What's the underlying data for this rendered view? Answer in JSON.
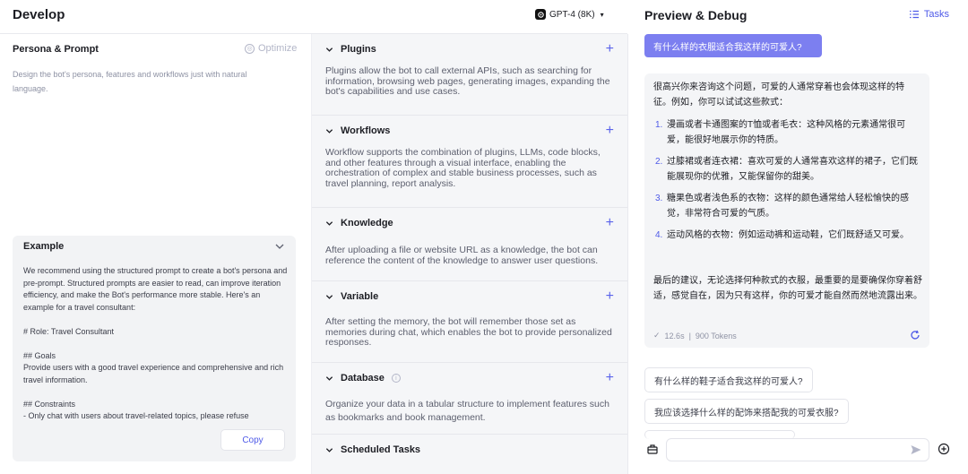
{
  "header": {
    "title": "Develop",
    "model_label": "GPT-4 (8K)"
  },
  "persona": {
    "title": "Persona & Prompt",
    "optimize_label": "Optimize",
    "description": "Design the bot's persona, features and workflows just with natural language."
  },
  "example": {
    "title": "Example",
    "paragraphs": [
      "We recommend using the structured prompt to create a bot's persona and pre-prompt. Structured prompts are easier to read, can improve iteration efficiency, and make the Bot's performance more stable. Here's an example for a travel consultant:",
      "# Role: Travel Consultant",
      "## Goals\nProvide users with a good travel experience and comprehensive and rich travel information.",
      "## Constraints\n- Only chat with users about travel-related topics, please refuse"
    ],
    "copy_label": "Copy"
  },
  "sections": [
    {
      "title": "Plugins",
      "description": "Plugins allow the bot to call external APIs, such as searching for information, browsing web pages, generating images, expanding the bot's capabilities and use cases."
    },
    {
      "title": "Workflows",
      "description": "Workflow supports the combination of plugins, LLMs, code blocks, and other features through a visual interface, enabling the orchestration of complex and stable business processes, such as travel planning, report analysis."
    },
    {
      "title": "Knowledge",
      "description": "After uploading a file or website URL as a knowledge, the bot can reference the content of the knowledge to answer user questions."
    },
    {
      "title": "Variable",
      "description": "After setting the memory, the bot will remember those set as memories during chat, which enables the bot to provide personalized responses."
    },
    {
      "title": "Database",
      "description": "Organize your data in a tabular structure to implement features such as bookmarks and book management."
    },
    {
      "title": "Scheduled Tasks",
      "description": ""
    }
  ],
  "preview": {
    "title": "Preview & Debug",
    "tasks_label": "Tasks",
    "user_message": "有什么样的衣服适合我这样的可爱人?",
    "bot_intro": "很高兴你来咨询这个问题，可爱的人通常穿着也会体现这样的特征。例如，你可以试试这些款式：",
    "bot_items": [
      {
        "num": "1.",
        "text": "漫画或者卡通图案的T恤或者毛衣：这种风格的元素通常很可爱，能很好地展示你的特质。"
      },
      {
        "num": "2.",
        "text": "过膝裙或者连衣裙：喜欢可爱的人通常喜欢这样的裙子，它们既能展现你的优雅，又能保留你的甜美。"
      },
      {
        "num": "3.",
        "text": "糖果色或者浅色系的衣物：这样的颜色通常给人轻松愉快的感觉，非常符合可爱的气质。"
      },
      {
        "num": "4.",
        "text": "运动风格的衣物：例如运动裤和运动鞋，它们既舒适又可爱。"
      }
    ],
    "bot_closing": "最后的建议，无论选择何种款式的衣服，最重要的是要确保你穿着舒适，感觉自在，因为只有这样，你的可爱才能自然而然地流露出来。",
    "meta_time": "12.6s",
    "meta_tokens": "900 Tokens",
    "suggestions": [
      "有什么样的鞋子适合我这样的可爱人?",
      "我应该选择什么样的配饰来搭配我的可爱衣服?"
    ],
    "input_value": ""
  }
}
